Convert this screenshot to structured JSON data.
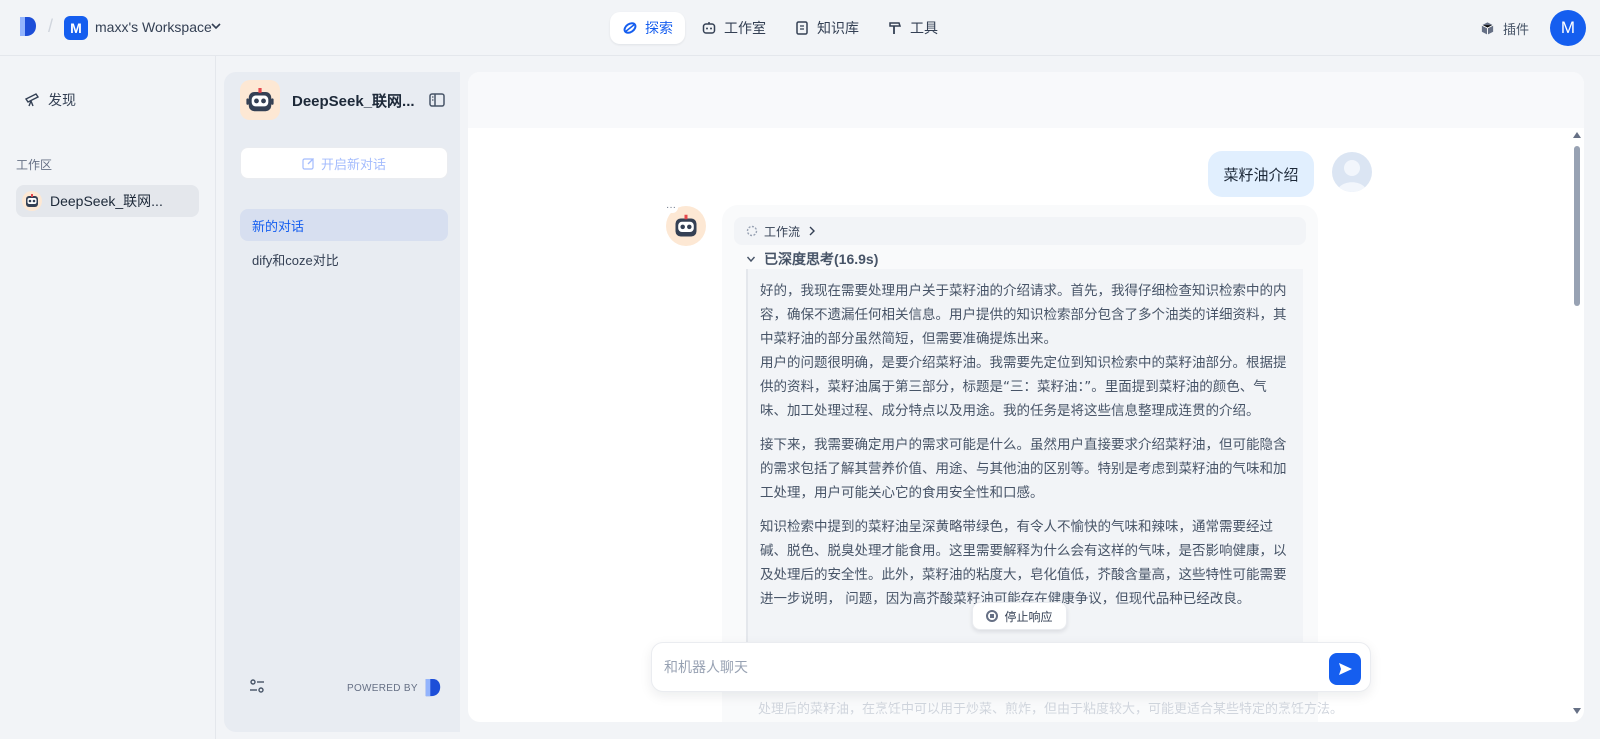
{
  "topbar": {
    "workspace_initial": "M",
    "workspace_name": "maxx's Workspace",
    "nav": [
      {
        "label": "探索",
        "icon": "compass-icon",
        "active": true
      },
      {
        "label": "工作室",
        "icon": "robot-icon",
        "active": false
      },
      {
        "label": "知识库",
        "icon": "book-icon",
        "active": false
      },
      {
        "label": "工具",
        "icon": "hammer-icon",
        "active": false
      }
    ],
    "plugin_label": "插件",
    "user_initial": "M"
  },
  "sidebar": {
    "discover_label": "发现",
    "workspace_section_label": "工作区",
    "app_item_label": "DeepSeek_联网..."
  },
  "conversation_panel": {
    "app_title": "DeepSeek_联网...",
    "new_chat_label": "开启新对话",
    "conversations": [
      {
        "label": "新的对话",
        "active": true
      },
      {
        "label": "dify和coze对比",
        "active": false
      }
    ],
    "powered_by": "POWERED BY"
  },
  "chat": {
    "user_message": "菜籽油介绍",
    "workflow_label": "工作流",
    "thinking_title": "已深度思考(16.9s)",
    "thinking_paragraphs": [
      "好的，我现在需要处理用户关于菜籽油的介绍请求。首先，我得仔细检查知识检索中的内容，确保不遗漏任何相关信息。用户提供的知识检索部分包含了多个油类的详细资料，其中菜籽油的部分虽然简短，但需要准确提炼出来。",
      "用户的问题很明确，是要介绍菜籽油。我需要先定位到知识检索中的菜籽油部分。根据提供的资料，菜籽油属于第三部分，标题是“三：菜籽油：”。里面提到菜籽油的颜色、气味、加工处理过程、成分特点以及用途。我的任务是将这些信息整理成连贯的介绍。",
      "接下来，我需要确定用户的需求可能是什么。虽然用户直接要求介绍菜籽油，但可能隐含的需求包括了解其营养价值、用途、与其他油的区别等。特别是考虑到菜籽油的气味和加工处理，用户可能关心它的食用安全性和口感。",
      "知识检索中提到的菜籽油呈深黄略带绿色，有令人不愉快的气味和辣味，通常需要经过碱、脱色、脱臭处理才能食用。这里需要解释为什么会有这样的气味，是否影响健康，以及处理后的安全性。此外，菜籽油的粘度大，皂化值低，芥酸含量高，这些特性可能需要进一步说明，              问题，因为高芥酸菜籽油可能存在健康争议，但现代品种已经改良。"
    ],
    "stop_label": "停止响应",
    "input_placeholder": "和机器人聊天",
    "faded_text": "处理后的菜籽油，在烹饪中可以用于炒菜、煎炸，但由于粘度较大，可能更适合某些特定的烹饪方法。"
  },
  "colors": {
    "primary": "#155eef",
    "page_bg": "#f2f4f7",
    "user_bubble": "#e1effe",
    "robot_avatar_bg": "#fde8d4"
  }
}
